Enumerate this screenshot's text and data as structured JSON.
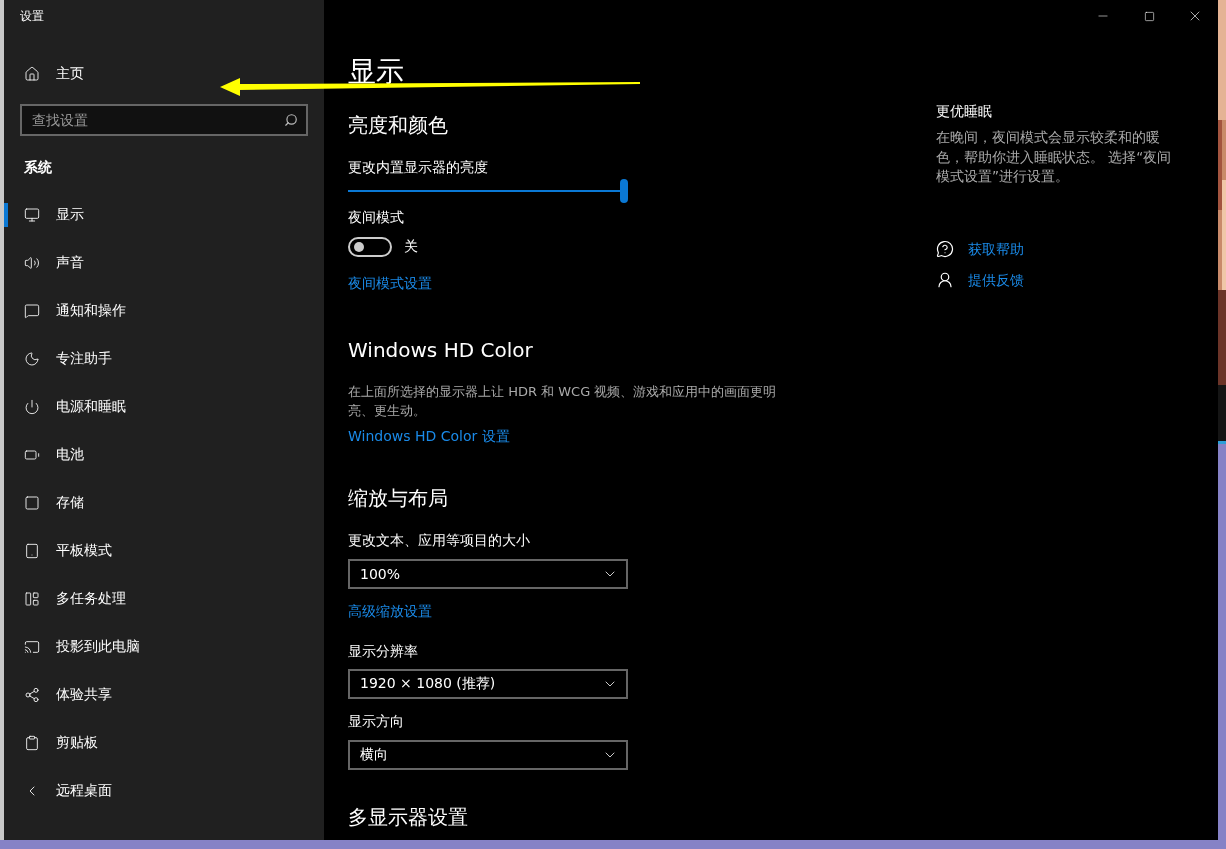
{
  "window": {
    "title": "设置"
  },
  "sidebar": {
    "home": "主页",
    "search": {
      "placeholder": "查找设置"
    },
    "section": "系统",
    "items": [
      {
        "label": "显示",
        "selected": true
      },
      {
        "label": "声音",
        "selected": false
      },
      {
        "label": "通知和操作",
        "selected": false
      },
      {
        "label": "专注助手",
        "selected": false
      },
      {
        "label": "电源和睡眠",
        "selected": false
      },
      {
        "label": "电池",
        "selected": false
      },
      {
        "label": "存储",
        "selected": false
      },
      {
        "label": "平板模式",
        "selected": false
      },
      {
        "label": "多任务处理",
        "selected": false
      },
      {
        "label": "投影到此电脑",
        "selected": false
      },
      {
        "label": "体验共享",
        "selected": false
      },
      {
        "label": "剪贴板",
        "selected": false
      },
      {
        "label": "远程桌面",
        "selected": false
      }
    ]
  },
  "main": {
    "title": "显示",
    "blocks": [
      {
        "kind": "heading",
        "text": "亮度和颜色"
      },
      {
        "kind": "label",
        "text": "更改内置显示器的亮度"
      },
      {
        "kind": "slider",
        "level": 1
      },
      {
        "kind": "label",
        "text": "夜间模式"
      },
      {
        "kind": "toggle",
        "on": false,
        "text": "关"
      },
      {
        "kind": "link",
        "text": "夜间模式设置"
      },
      {
        "kind": "heading",
        "text": "Windows HD Color"
      },
      {
        "kind": "paragraph",
        "text": "在上面所选择的显示器上让 HDR 和 WCG 视频、游戏和应用中的画面更明亮、更生动。"
      },
      {
        "kind": "link",
        "text": "Windows HD Color 设置"
      },
      {
        "kind": "heading",
        "text": "缩放与布局"
      },
      {
        "kind": "label",
        "text": "更改文本、应用等项目的大小"
      },
      {
        "kind": "dropdown",
        "value": "100%"
      },
      {
        "kind": "link",
        "text": "高级缩放设置"
      },
      {
        "kind": "label",
        "text": "显示分辨率"
      },
      {
        "kind": "dropdown",
        "value": "1920 × 1080 (推荐)"
      },
      {
        "kind": "label",
        "text": "显示方向"
      },
      {
        "kind": "dropdown",
        "value": "横向"
      },
      {
        "kind": "heading",
        "text": "多显示器设置"
      }
    ]
  },
  "aside": {
    "title": "更优睡眠",
    "text": "在晚间，夜间模式会显示较柔和的暖色，帮助你进入睡眠状态。 选择“夜间模式设置”进行设置。",
    "links": [
      "获取帮助",
      "提供反馈"
    ]
  }
}
